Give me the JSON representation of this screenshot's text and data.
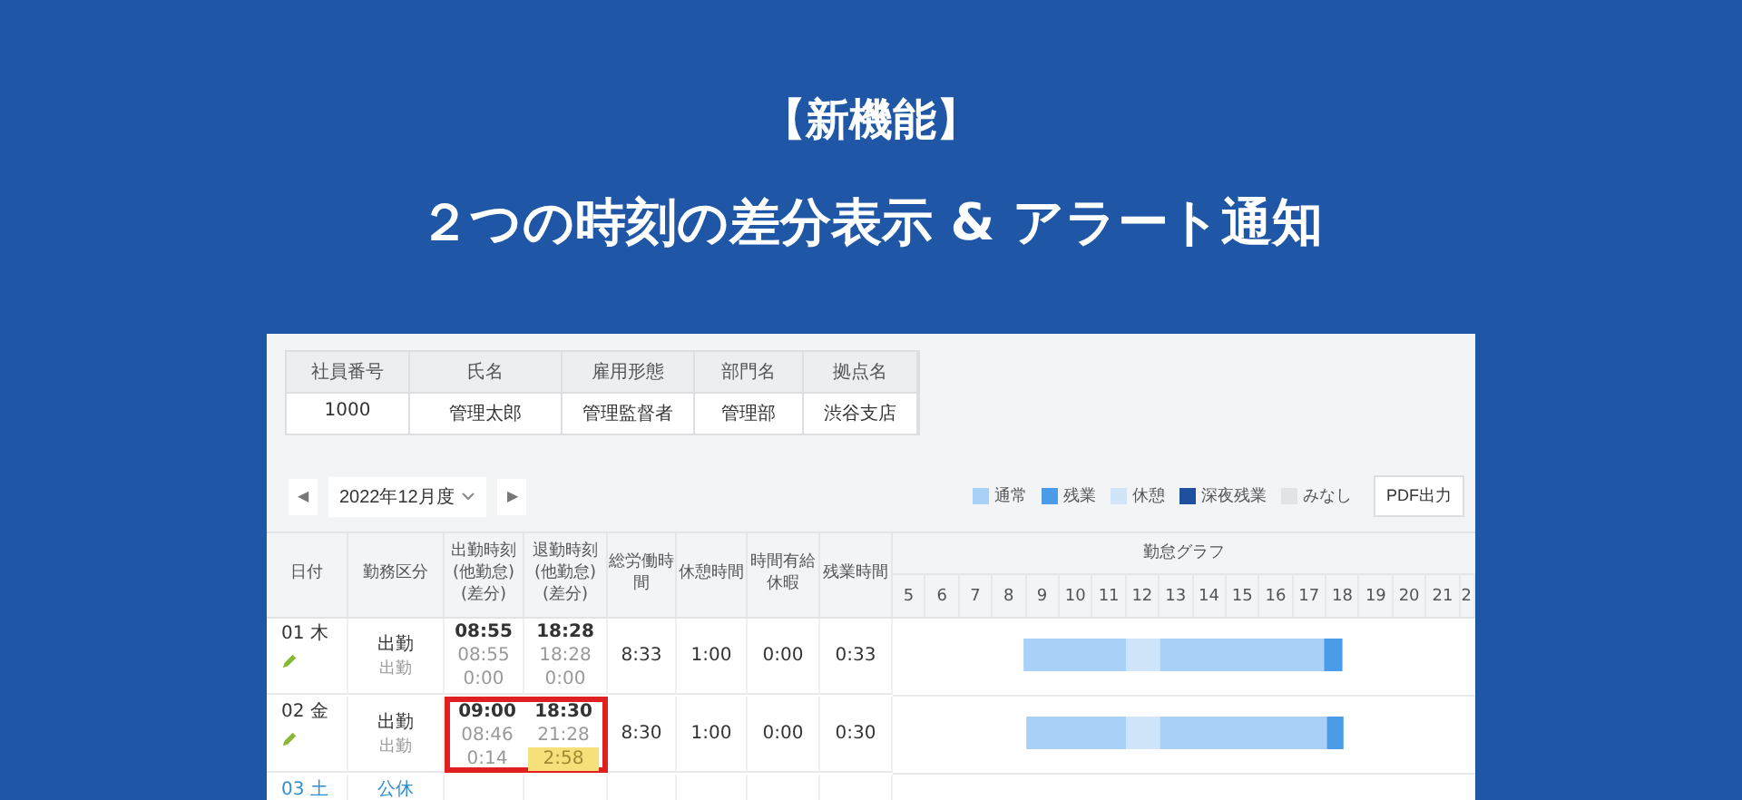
{
  "banner": {
    "tag": "【新機能】",
    "headline": "２つの時刻の差分表示 & アラート通知"
  },
  "employee": {
    "columns": [
      "社員番号",
      "氏名",
      "雇用形態",
      "部門名",
      "拠点名"
    ],
    "values": [
      "1000",
      "管理太郎",
      "管理監督者",
      "管理部",
      "渋谷支店"
    ]
  },
  "period": {
    "prev": "◀",
    "value": "2022年12月度",
    "next": "▶"
  },
  "legend": [
    {
      "label": "通常",
      "color": "#a9d1f7"
    },
    {
      "label": "残業",
      "color": "#4a9be8"
    },
    {
      "label": "休憩",
      "color": "#d0e5fa"
    },
    {
      "label": "深夜残業",
      "color": "#1f4f9f"
    },
    {
      "label": "みなし",
      "color": "#e2e3e5"
    }
  ],
  "pdf_button": "PDF出力",
  "table": {
    "columns": [
      "日付",
      "勤務区分",
      "出勤時刻\n(他勤怠)\n(差分)",
      "退勤時刻\n(他勤怠)\n(差分)",
      "総労働時間",
      "休憩時間",
      "時間有給休暇",
      "残業時間"
    ],
    "graph_title": "勤怠グラフ",
    "hours": [
      "5",
      "6",
      "7",
      "8",
      "9",
      "10",
      "11",
      "12",
      "13",
      "14",
      "15",
      "16",
      "17",
      "18",
      "19",
      "20",
      "21",
      "2"
    ],
    "rows": [
      {
        "kind": "workday",
        "day": "01",
        "weekday": "木",
        "type": "出勤",
        "type_other": "出勤",
        "clock_in": {
          "time": "08:55",
          "other": "08:55",
          "diff": "0:00",
          "alert": false
        },
        "clock_out": {
          "time": "18:28",
          "other": "18:28",
          "diff": "0:00",
          "alert": false
        },
        "highlighted": false,
        "total": "8:33",
        "break": "1:00",
        "paid_leave": "0:00",
        "overtime": "0:33"
      },
      {
        "kind": "workday",
        "day": "02",
        "weekday": "金",
        "type": "出勤",
        "type_other": "出勤",
        "clock_in": {
          "time": "09:00",
          "other": "08:46",
          "diff": "0:14",
          "alert": false
        },
        "clock_out": {
          "time": "18:30",
          "other": "21:28",
          "diff": "2:58",
          "alert": true
        },
        "highlighted": true,
        "total": "8:30",
        "break": "1:00",
        "paid_leave": "0:00",
        "overtime": "0:30"
      },
      {
        "kind": "holiday",
        "day": "03",
        "weekday": "土",
        "type": "公休"
      }
    ]
  }
}
